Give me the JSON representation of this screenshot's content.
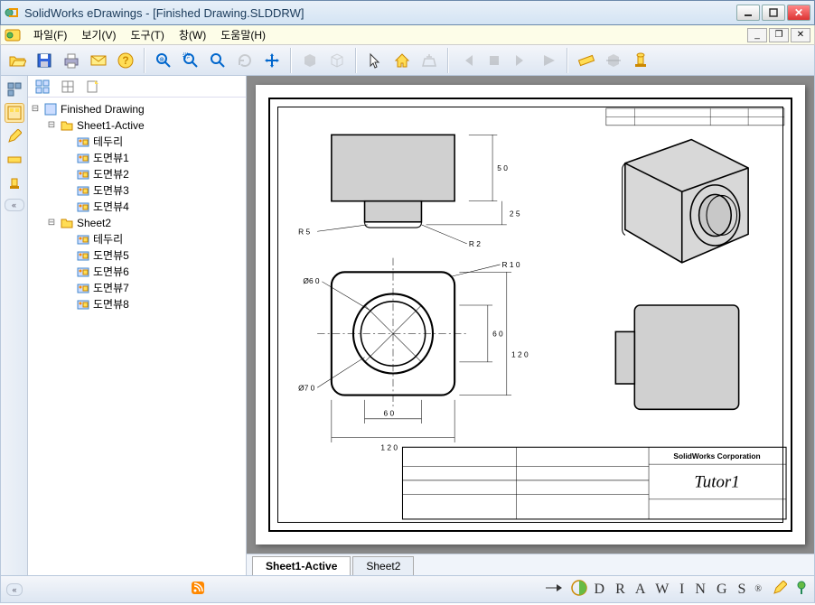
{
  "window": {
    "title": "SolidWorks eDrawings - [Finished Drawing.SLDDRW]"
  },
  "menu": {
    "items": [
      "파일(F)",
      "보기(V)",
      "도구(T)",
      "창(W)",
      "도움말(H)"
    ]
  },
  "tree": {
    "root": "Finished Drawing",
    "sheet1": "Sheet1-Active",
    "sheet1_items": [
      "테두리",
      "도면뷰1",
      "도면뷰2",
      "도면뷰3",
      "도면뷰4"
    ],
    "sheet2": "Sheet2",
    "sheet2_items": [
      "테두리",
      "도면뷰5",
      "도면뷰6",
      "도면뷰7",
      "도면뷰8"
    ]
  },
  "drawing": {
    "dims": {
      "d50": "5 0",
      "d25": "2 5",
      "r5": "R 5",
      "r2": "R 2",
      "r10": "R 1 0",
      "d60": "6 0",
      "d120": "1 2 0",
      "d60w": "6 0",
      "d120w": "1 2 0",
      "dia60": "Ø6 0",
      "dia70": "Ø7 0"
    },
    "titleblock": {
      "company": "SolidWorks Corporation",
      "name": "Tutor1"
    }
  },
  "tabs": {
    "items": [
      "Sheet1-Active",
      "Sheet2"
    ]
  },
  "brand": "D R A W I N G S"
}
